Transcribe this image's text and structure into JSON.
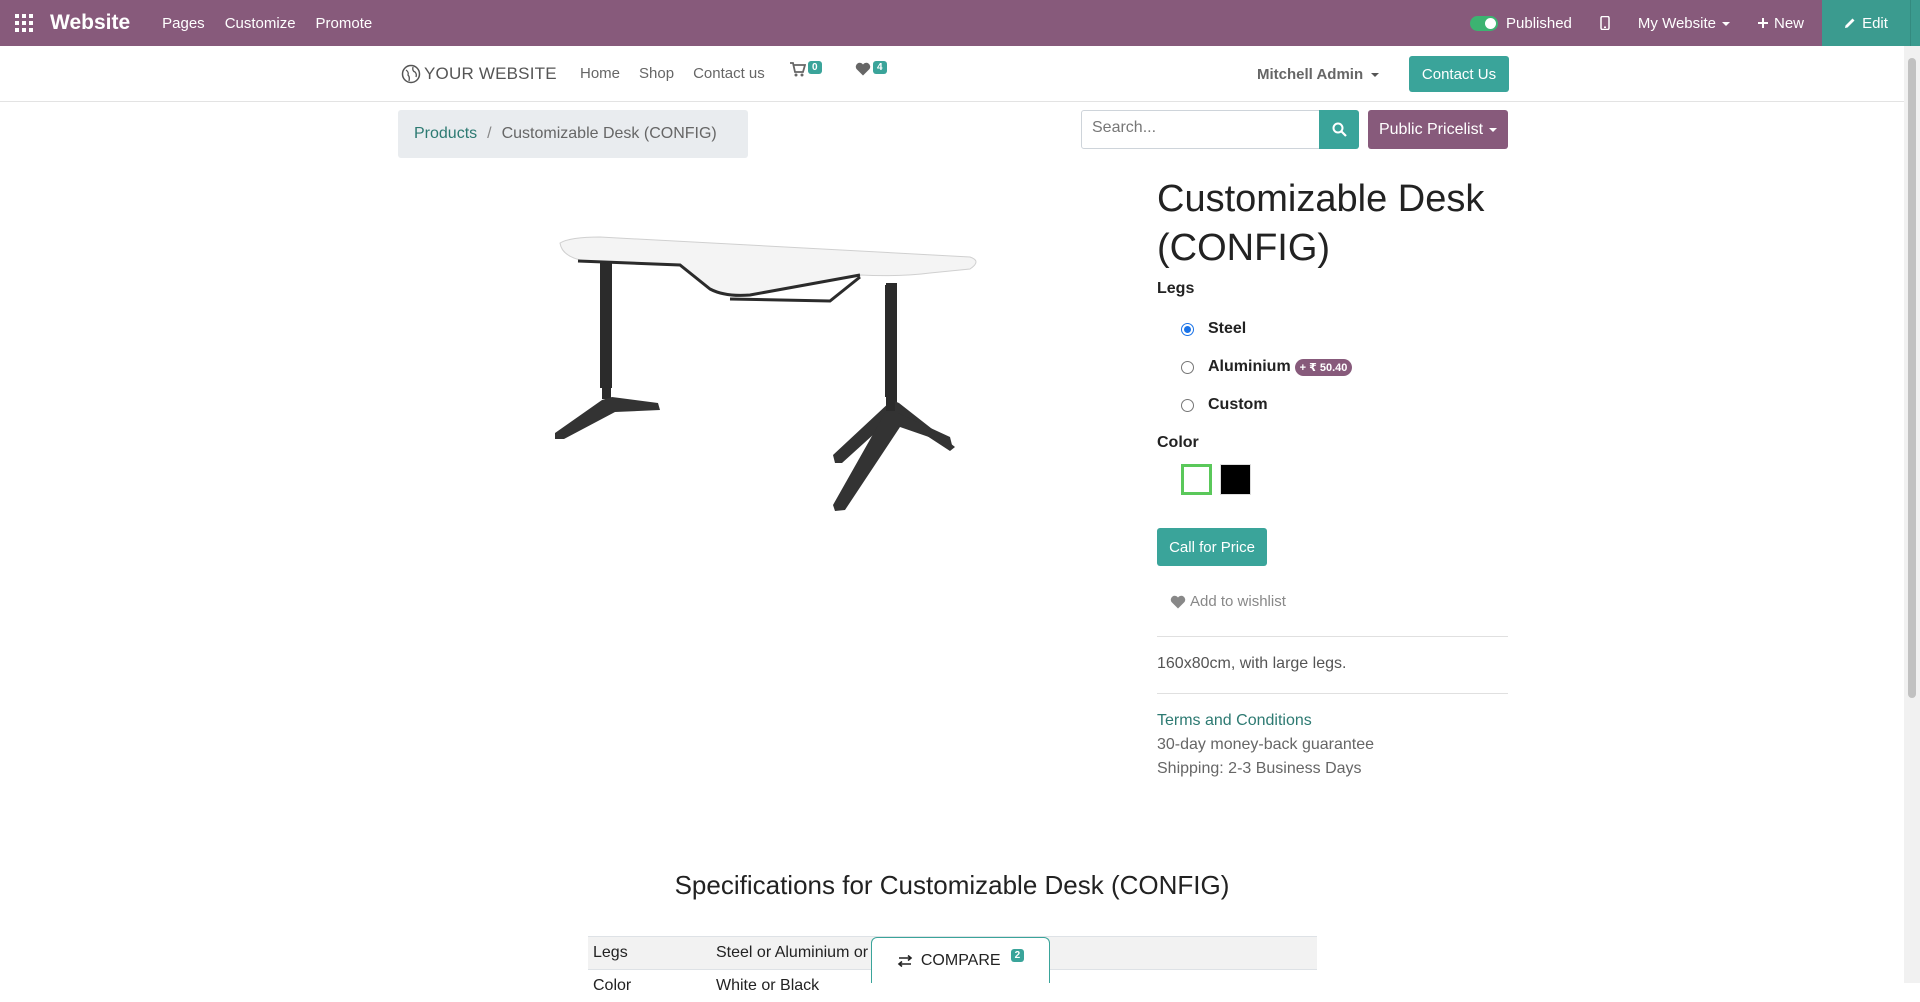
{
  "adminbar": {
    "brand": "Website",
    "menu": [
      "Pages",
      "Customize",
      "Promote"
    ],
    "published": "Published",
    "my_website": "My Website",
    "new": "New",
    "edit": "Edit"
  },
  "header": {
    "logo": "YOUR WEBSITE",
    "nav": [
      "Home",
      "Shop",
      "Contact us"
    ],
    "cart_count": "0",
    "wishlist_count": "4",
    "user": "Mitchell Admin",
    "contact_btn": "Contact Us"
  },
  "breadcrumb": {
    "parent": "Products",
    "separator": "/",
    "current": "Customizable Desk (CONFIG)"
  },
  "search": {
    "placeholder": "Search...",
    "pricelist": "Public Pricelist"
  },
  "product": {
    "title": "Customizable Desk (CONFIG)",
    "legs_label": "Legs",
    "legs_options": [
      {
        "label": "Steel",
        "selected": true
      },
      {
        "label": "Aluminium",
        "extra": "+ ₹ 50.40"
      },
      {
        "label": "Custom"
      }
    ],
    "color_label": "Color",
    "colors": [
      "#ffffff",
      "#000000"
    ],
    "call_for_price": "Call for Price",
    "add_to_wishlist": "Add to wishlist",
    "description": "160x80cm, with large legs.",
    "terms": "Terms and Conditions",
    "guarantee": "30-day money-back guarantee",
    "shipping": "Shipping: 2-3 Business Days"
  },
  "specs": {
    "title": "Specifications for Customizable Desk (CONFIG)",
    "rows": [
      {
        "key": "Legs",
        "value": "Steel or Aluminium or Custom"
      },
      {
        "key": "Color",
        "value": "White or Black"
      }
    ]
  },
  "compare": {
    "label": "COMPARE",
    "count": "2"
  }
}
